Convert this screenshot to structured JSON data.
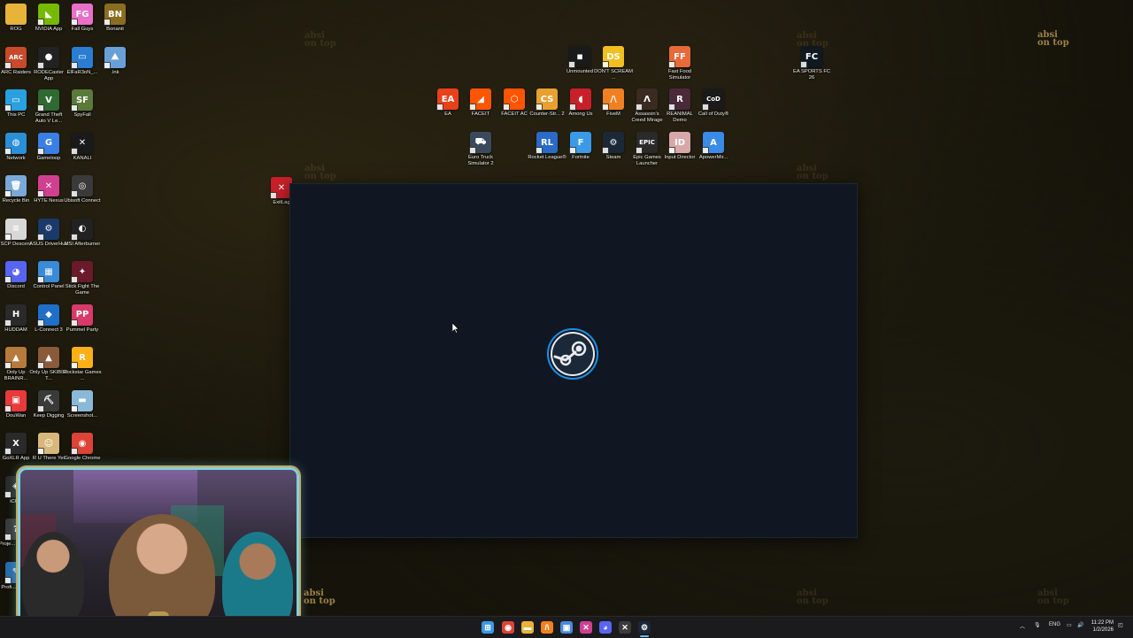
{
  "watermark": {
    "line1": "absi",
    "line2": "on top"
  },
  "desktop_left": [
    {
      "label": "ROG",
      "icon": "folder-icon",
      "color": "#e8b339",
      "glyph": ""
    },
    {
      "label": "NVIDIA App",
      "icon": "nvidia-icon",
      "color": "#76b900",
      "glyph": "◣"
    },
    {
      "label": "Fall Guys",
      "icon": "fall-guys-icon",
      "color": "#e870c8",
      "glyph": "FG"
    },
    {
      "label": "Bonanit",
      "icon": "bonanit-icon",
      "color": "#8a6d1f",
      "glyph": "BN"
    },
    {
      "label": "ARC Raiders",
      "icon": "arc-raiders-icon",
      "color": "#c84a2a",
      "glyph": "ARC"
    },
    {
      "label": "RODECaster App",
      "icon": "rodecaster-icon",
      "color": "#222222",
      "glyph": "●"
    },
    {
      "label": "ElFaR3oN_...",
      "icon": "text-file-icon",
      "color": "#2b7cd3",
      "glyph": "▭"
    },
    {
      "label": ".lnk",
      "icon": "shortcut-icon",
      "color": "#6aa0d8",
      "glyph": "⛰"
    },
    {
      "label": "This PC",
      "icon": "this-pc-icon",
      "color": "#29a0e0",
      "glyph": "▭"
    },
    {
      "label": "Grand Theft Auto V Le...",
      "icon": "gta-icon",
      "color": "#2f6a33",
      "glyph": "V"
    },
    {
      "label": "SpyFall",
      "icon": "spyfall-icon",
      "color": "#5a7a3a",
      "glyph": "SF"
    },
    {
      "label": "Network",
      "icon": "network-icon",
      "color": "#2b8fd8",
      "glyph": "◍"
    },
    {
      "label": "Gameloop",
      "icon": "gameloop-icon",
      "color": "#3a7ee6",
      "glyph": "G"
    },
    {
      "label": "KANALI",
      "icon": "kanali-icon",
      "color": "#1a1a1a",
      "glyph": "✕"
    },
    {
      "label": "Recycle Bin",
      "icon": "recycle-bin-icon",
      "color": "#7aa8d8",
      "glyph": "🗑"
    },
    {
      "label": "HYTE Nexus",
      "icon": "hyte-nexus-icon",
      "color": "#d04090",
      "glyph": "✕"
    },
    {
      "label": "Ubisoft Connect",
      "icon": "ubisoft-icon",
      "color": "#3a3a3a",
      "glyph": "◎"
    },
    {
      "label": "SCP Descent",
      "icon": "scp-descent-icon",
      "color": "#d8d8d8",
      "glyph": "≡"
    },
    {
      "label": "ASUS DriverHub",
      "icon": "asus-driverhub-icon",
      "color": "#1a3a6a",
      "glyph": "⚙"
    },
    {
      "label": "MSI Afterburner",
      "icon": "msi-afterburner-icon",
      "color": "#222222",
      "glyph": "◐"
    },
    {
      "label": "Discord",
      "icon": "discord-icon",
      "color": "#5865f2",
      "glyph": "◕"
    },
    {
      "label": "Control Panel",
      "icon": "control-panel-icon",
      "color": "#3a8ad8",
      "glyph": "▦"
    },
    {
      "label": "Stick Fight The Game",
      "icon": "stick-fight-icon",
      "color": "#6a1a2a",
      "glyph": "✦"
    },
    {
      "label": "HUDDAM",
      "icon": "huddam-icon",
      "color": "#2a2a2a",
      "glyph": "H"
    },
    {
      "label": "L-Connect 3",
      "icon": "l-connect-icon",
      "color": "#1f6fc8",
      "glyph": "◆"
    },
    {
      "label": "Pummel Party",
      "icon": "pummel-party-icon",
      "color": "#d83a6a",
      "glyph": "PP"
    },
    {
      "label": "Only Up BRAINR...",
      "icon": "only-up-icon",
      "color": "#b87a3a",
      "glyph": "▲"
    },
    {
      "label": "Only Up SKIBIDI T...",
      "icon": "only-up-skibidi-icon",
      "color": "#8a5a3a",
      "glyph": "▲"
    },
    {
      "label": "Rockstar Games ...",
      "icon": "rockstar-icon",
      "color": "#fcaf17",
      "glyph": "R"
    },
    {
      "label": "DouWan",
      "icon": "douwan-icon",
      "color": "#e83a3a",
      "glyph": "▣"
    },
    {
      "label": "Keep Digging",
      "icon": "keep-digging-icon",
      "color": "#3a3a3a",
      "glyph": "⛏"
    },
    {
      "label": "Screenshot...",
      "icon": "screenshot-icon",
      "color": "#8ab8d8",
      "glyph": "▬"
    },
    {
      "label": "GoXLR App",
      "icon": "goxlr-icon",
      "color": "#2a2a2a",
      "glyph": "X"
    },
    {
      "label": "R U There Yet",
      "icon": "ru-there-yet-icon",
      "color": "#d8b87a",
      "glyph": "☺"
    },
    {
      "label": "Google Chrome",
      "icon": "chrome-icon",
      "color": "#db4437",
      "glyph": "◉"
    },
    {
      "label": "iCUE",
      "icon": "icue-icon",
      "color": "#2a2a2a",
      "glyph": "◈"
    },
    {
      "label": "Proje... Unkn...",
      "icon": "project-unknown-icon",
      "color": "#3a3a3a",
      "glyph": "?"
    },
    {
      "label": "Profi... Edit...",
      "icon": "profile-editor-icon",
      "color": "#2a6aa8",
      "glyph": "✎"
    }
  ],
  "exitlag": {
    "label": "ExitLag",
    "icon": "exitlag-icon",
    "color": "#c8202a",
    "glyph": "✕"
  },
  "desktop_center": [
    {
      "label": "Unmounted",
      "icon": "unmounted-icon",
      "color": "#1a1a1a",
      "glyph": "◾"
    },
    {
      "label": "DON'T SCREAM ...",
      "icon": "dont-scream-icon",
      "color": "#f0c020",
      "glyph": "DS"
    },
    {
      "label": "Fast Food Simulator",
      "icon": "fast-food-icon",
      "color": "#e86a3a",
      "glyph": "FF"
    },
    {
      "label": "EA SPORTS FC 26",
      "icon": "ea-fc-icon",
      "color": "#101820",
      "glyph": "FC"
    },
    {
      "label": "EA",
      "icon": "ea-icon",
      "color": "#e8401a",
      "glyph": "EA"
    },
    {
      "label": "FACEIT",
      "icon": "faceit-icon",
      "color": "#ff5500",
      "glyph": "◢"
    },
    {
      "label": "FACEIT AC",
      "icon": "faceit-ac-icon",
      "color": "#ff5500",
      "glyph": "⬡"
    },
    {
      "label": "Counter-Str... 2",
      "icon": "cs2-icon",
      "color": "#e8a030",
      "glyph": "CS"
    },
    {
      "label": "Among Us",
      "icon": "among-us-icon",
      "color": "#c8202a",
      "glyph": "◖"
    },
    {
      "label": "FiveM",
      "icon": "fivem-icon",
      "color": "#f08020",
      "glyph": "/\\"
    },
    {
      "label": "Assassin's Creed Mirage",
      "icon": "ac-mirage-icon",
      "color": "#3a2a20",
      "glyph": "Λ"
    },
    {
      "label": "REANIMAL Demo",
      "icon": "reanimal-icon",
      "color": "#4a2a3a",
      "glyph": "R"
    },
    {
      "label": "Call of Duty®",
      "icon": "call-of-duty-icon",
      "color": "#1a1a1a",
      "glyph": "CoD"
    },
    {
      "label": "Euro Truck Simulator 2",
      "icon": "euro-truck-icon",
      "color": "#3a4a5a",
      "glyph": "⛟"
    },
    {
      "label": "Rocket League®",
      "icon": "rocket-league-icon",
      "color": "#2a6ac8",
      "glyph": "RL"
    },
    {
      "label": "Fortnite",
      "icon": "fortnite-icon",
      "color": "#3a9ae8",
      "glyph": "F"
    },
    {
      "label": "Steam",
      "icon": "steam-icon",
      "color": "#1b2838",
      "glyph": "⚙"
    },
    {
      "label": "Epic Games Launcher",
      "icon": "epic-games-icon",
      "color": "#2a2a2a",
      "glyph": "EPIC"
    },
    {
      "label": "Input Director",
      "icon": "input-director-icon",
      "color": "#d8a8a8",
      "glyph": "ID"
    },
    {
      "label": "ApowerMir...",
      "icon": "apowermirror-icon",
      "color": "#3a8ae8",
      "glyph": "A"
    }
  ],
  "steam_window": {
    "logo": "steam-logo-icon"
  },
  "taskbar": {
    "apps": [
      {
        "name": "start-button",
        "icon": "windows-icon",
        "color": "#3a9ae8",
        "glyph": "⊞"
      },
      {
        "name": "taskbar-chrome",
        "icon": "chrome-icon",
        "color": "#db4437",
        "glyph": "◉"
      },
      {
        "name": "taskbar-explorer",
        "icon": "folder-icon",
        "color": "#e8b339",
        "glyph": "▬"
      },
      {
        "name": "taskbar-fivem",
        "icon": "fivem-icon",
        "color": "#f08020",
        "glyph": "/\\"
      },
      {
        "name": "taskbar-app",
        "icon": "window-icon",
        "color": "#4a8ad8",
        "glyph": "▣"
      },
      {
        "name": "taskbar-hyte",
        "icon": "hyte-nexus-icon",
        "color": "#d04090",
        "glyph": "✕"
      },
      {
        "name": "taskbar-discord",
        "icon": "discord-icon",
        "color": "#5865f2",
        "glyph": "◕"
      },
      {
        "name": "taskbar-xbox",
        "icon": "xbox-icon",
        "color": "#3a3a3a",
        "glyph": "✕"
      },
      {
        "name": "taskbar-steam",
        "icon": "steam-icon",
        "color": "#1b2838",
        "glyph": "⚙"
      }
    ],
    "lang": "ENG",
    "time": "11:22 PM",
    "date": "1/2/2026"
  }
}
